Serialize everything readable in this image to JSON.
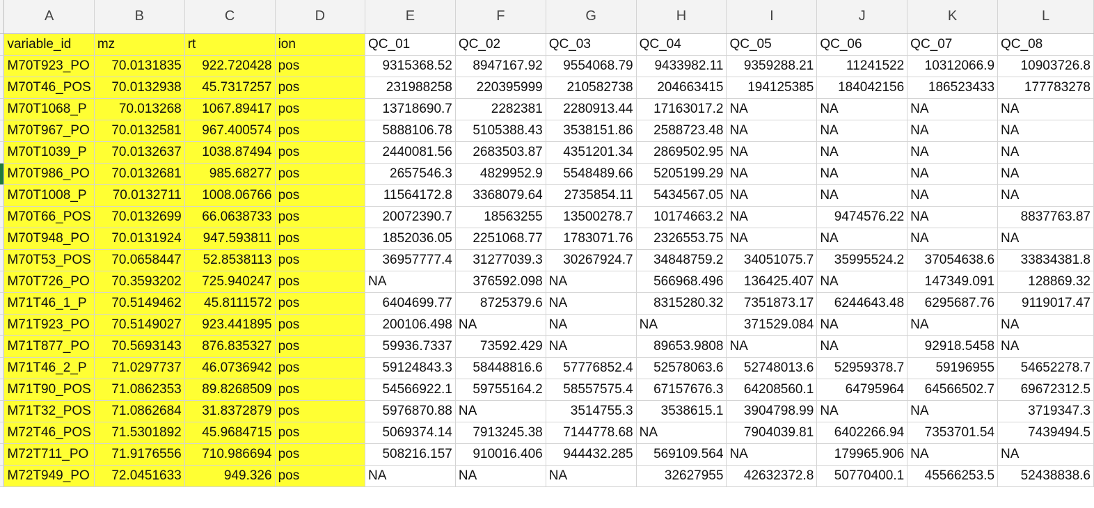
{
  "column_letters": [
    "A",
    "B",
    "C",
    "D",
    "E",
    "F",
    "G",
    "H",
    "I",
    "J",
    "K",
    "L"
  ],
  "header_row": [
    "variable_id",
    "mz",
    "rt",
    "ion",
    "",
    "QC_01",
    "QC_02",
    "QC_03",
    "QC_04",
    "QC_05",
    "QC_06",
    "QC_07",
    "QC_08"
  ],
  "highlight_color": "#ffff33",
  "active_row_index": 6,
  "rows": [
    [
      "M70T923_PO",
      "70.0131835",
      "922.720428",
      "pos",
      "9315368.52",
      "8947167.92",
      "9554068.79",
      "9433982.11",
      "9359288.21",
      "11241522",
      "10312066.9",
      "10903726.8"
    ],
    [
      "M70T46_POS",
      "70.0132938",
      "45.7317257",
      "pos",
      "231988258",
      "220395999",
      "210582738",
      "204663415",
      "194125385",
      "184042156",
      "186523433",
      "177783278"
    ],
    [
      "M70T1068_P",
      "70.013268",
      "1067.89417",
      "pos",
      "13718690.7",
      "2282381",
      "2280913.44",
      "17163017.2",
      "NA",
      "NA",
      "NA",
      "NA"
    ],
    [
      "M70T967_PO",
      "70.0132581",
      "967.400574",
      "pos",
      "5888106.78",
      "5105388.43",
      "3538151.86",
      "2588723.48",
      "NA",
      "NA",
      "NA",
      "NA"
    ],
    [
      "M70T1039_P",
      "70.0132637",
      "1038.87494",
      "pos",
      "2440081.56",
      "2683503.87",
      "4351201.34",
      "2869502.95",
      "NA",
      "NA",
      "NA",
      "NA"
    ],
    [
      "M70T986_PO",
      "70.0132681",
      "985.68277",
      "pos",
      "2657546.3",
      "4829952.9",
      "5548489.66",
      "5205199.29",
      "NA",
      "NA",
      "NA",
      "NA"
    ],
    [
      "M70T1008_P",
      "70.0132711",
      "1008.06766",
      "pos",
      "11564172.8",
      "3368079.64",
      "2735854.11",
      "5434567.05",
      "NA",
      "NA",
      "NA",
      "NA"
    ],
    [
      "M70T66_POS",
      "70.0132699",
      "66.0638733",
      "pos",
      "20072390.7",
      "18563255",
      "13500278.7",
      "10174663.2",
      "NA",
      "9474576.22",
      "NA",
      "8837763.87"
    ],
    [
      "M70T948_PO",
      "70.0131924",
      "947.593811",
      "pos",
      "1852036.05",
      "2251068.77",
      "1783071.76",
      "2326553.75",
      "NA",
      "NA",
      "NA",
      "NA"
    ],
    [
      "M70T53_POS",
      "70.0658447",
      "52.8538113",
      "pos",
      "36957777.4",
      "31277039.3",
      "30267924.7",
      "34848759.2",
      "34051075.7",
      "35995524.2",
      "37054638.6",
      "33834381.8"
    ],
    [
      "M70T726_PO",
      "70.3593202",
      "725.940247",
      "pos",
      "NA",
      "376592.098",
      "NA",
      "566968.496",
      "136425.407",
      "NA",
      "147349.091",
      "128869.32"
    ],
    [
      "M71T46_1_P",
      "70.5149462",
      "45.8111572",
      "pos",
      "6404699.77",
      "8725379.6",
      "NA",
      "8315280.32",
      "7351873.17",
      "6244643.48",
      "6295687.76",
      "9119017.47"
    ],
    [
      "M71T923_PO",
      "70.5149027",
      "923.441895",
      "pos",
      "200106.498",
      "NA",
      "NA",
      "NA",
      "371529.084",
      "NA",
      "NA",
      "NA"
    ],
    [
      "M71T877_PO",
      "70.5693143",
      "876.835327",
      "pos",
      "59936.7337",
      "73592.429",
      "NA",
      "89653.9808",
      "NA",
      "NA",
      "92918.5458",
      "NA"
    ],
    [
      "M71T46_2_P",
      "71.0297737",
      "46.0736942",
      "pos",
      "59124843.3",
      "58448816.6",
      "57776852.4",
      "52578063.6",
      "52748013.6",
      "52959378.7",
      "59196955",
      "54652278.7"
    ],
    [
      "M71T90_POS",
      "71.0862353",
      "89.8268509",
      "pos",
      "54566922.1",
      "59755164.2",
      "58557575.4",
      "67157676.3",
      "64208560.1",
      "64795964",
      "64566502.7",
      "69672312.5"
    ],
    [
      "M71T32_POS",
      "71.0862684",
      "31.8372879",
      "pos",
      "5976870.88",
      "NA",
      "3514755.3",
      "3538615.1",
      "3904798.99",
      "NA",
      "NA",
      "3719347.3"
    ],
    [
      "M72T46_POS",
      "71.5301892",
      "45.9684715",
      "pos",
      "5069374.14",
      "7913245.38",
      "7144778.68",
      "NA",
      "7904039.81",
      "6402266.94",
      "7353701.54",
      "7439494.5"
    ],
    [
      "M72T711_PO",
      "71.9176556",
      "710.986694",
      "pos",
      "508216.157",
      "910016.406",
      "944432.285",
      "569109.564",
      "NA",
      "179965.906",
      "NA",
      "NA"
    ],
    [
      "M72T949_PO",
      "72.0451633",
      "949.326",
      "pos",
      "NA",
      "NA",
      "NA",
      "32627955",
      "42632372.8",
      "50770400.1",
      "45566253.5",
      "52438838.6"
    ]
  ]
}
